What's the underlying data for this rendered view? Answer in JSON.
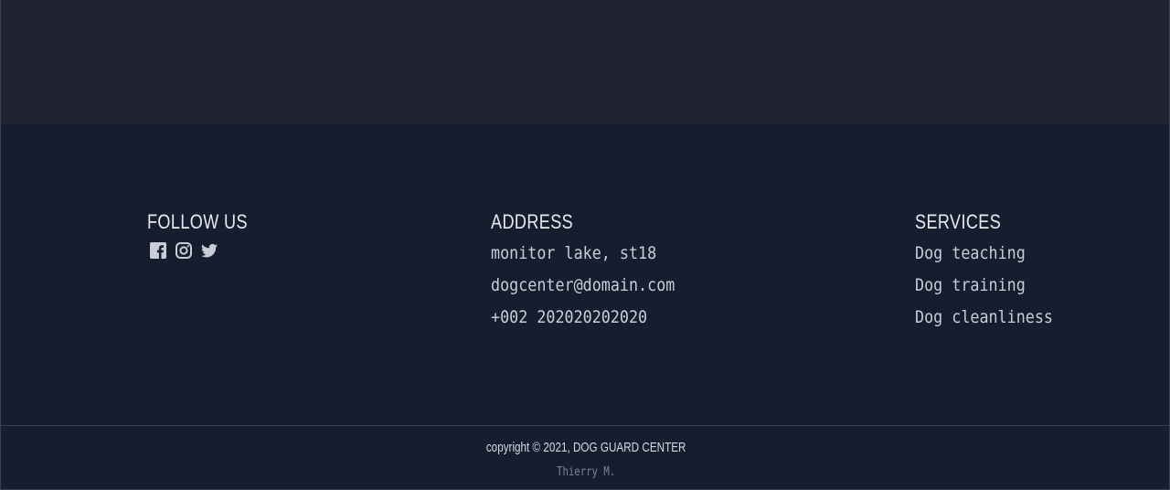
{
  "footer": {
    "follow": {
      "title": "FOLLOW US",
      "icons": [
        "facebook-icon",
        "instagram-icon",
        "twitter-icon"
      ]
    },
    "address": {
      "title": "ADDRESS",
      "lines": [
        "monitor lake, st18",
        "dogcenter@domain.com",
        "+002 202020202020"
      ]
    },
    "services": {
      "title": "SERVICES",
      "lines": [
        "Dog teaching",
        "Dog training",
        "Dog cleanliness"
      ]
    },
    "copyright": "copyright © 2021, DOG GUARD CENTER",
    "author": "Thierry M."
  },
  "colors": {
    "top_band": "#1f2332",
    "footer_bg": "#161d2f",
    "icon": "#c9cdd8",
    "divider": "#3a3f4e"
  }
}
